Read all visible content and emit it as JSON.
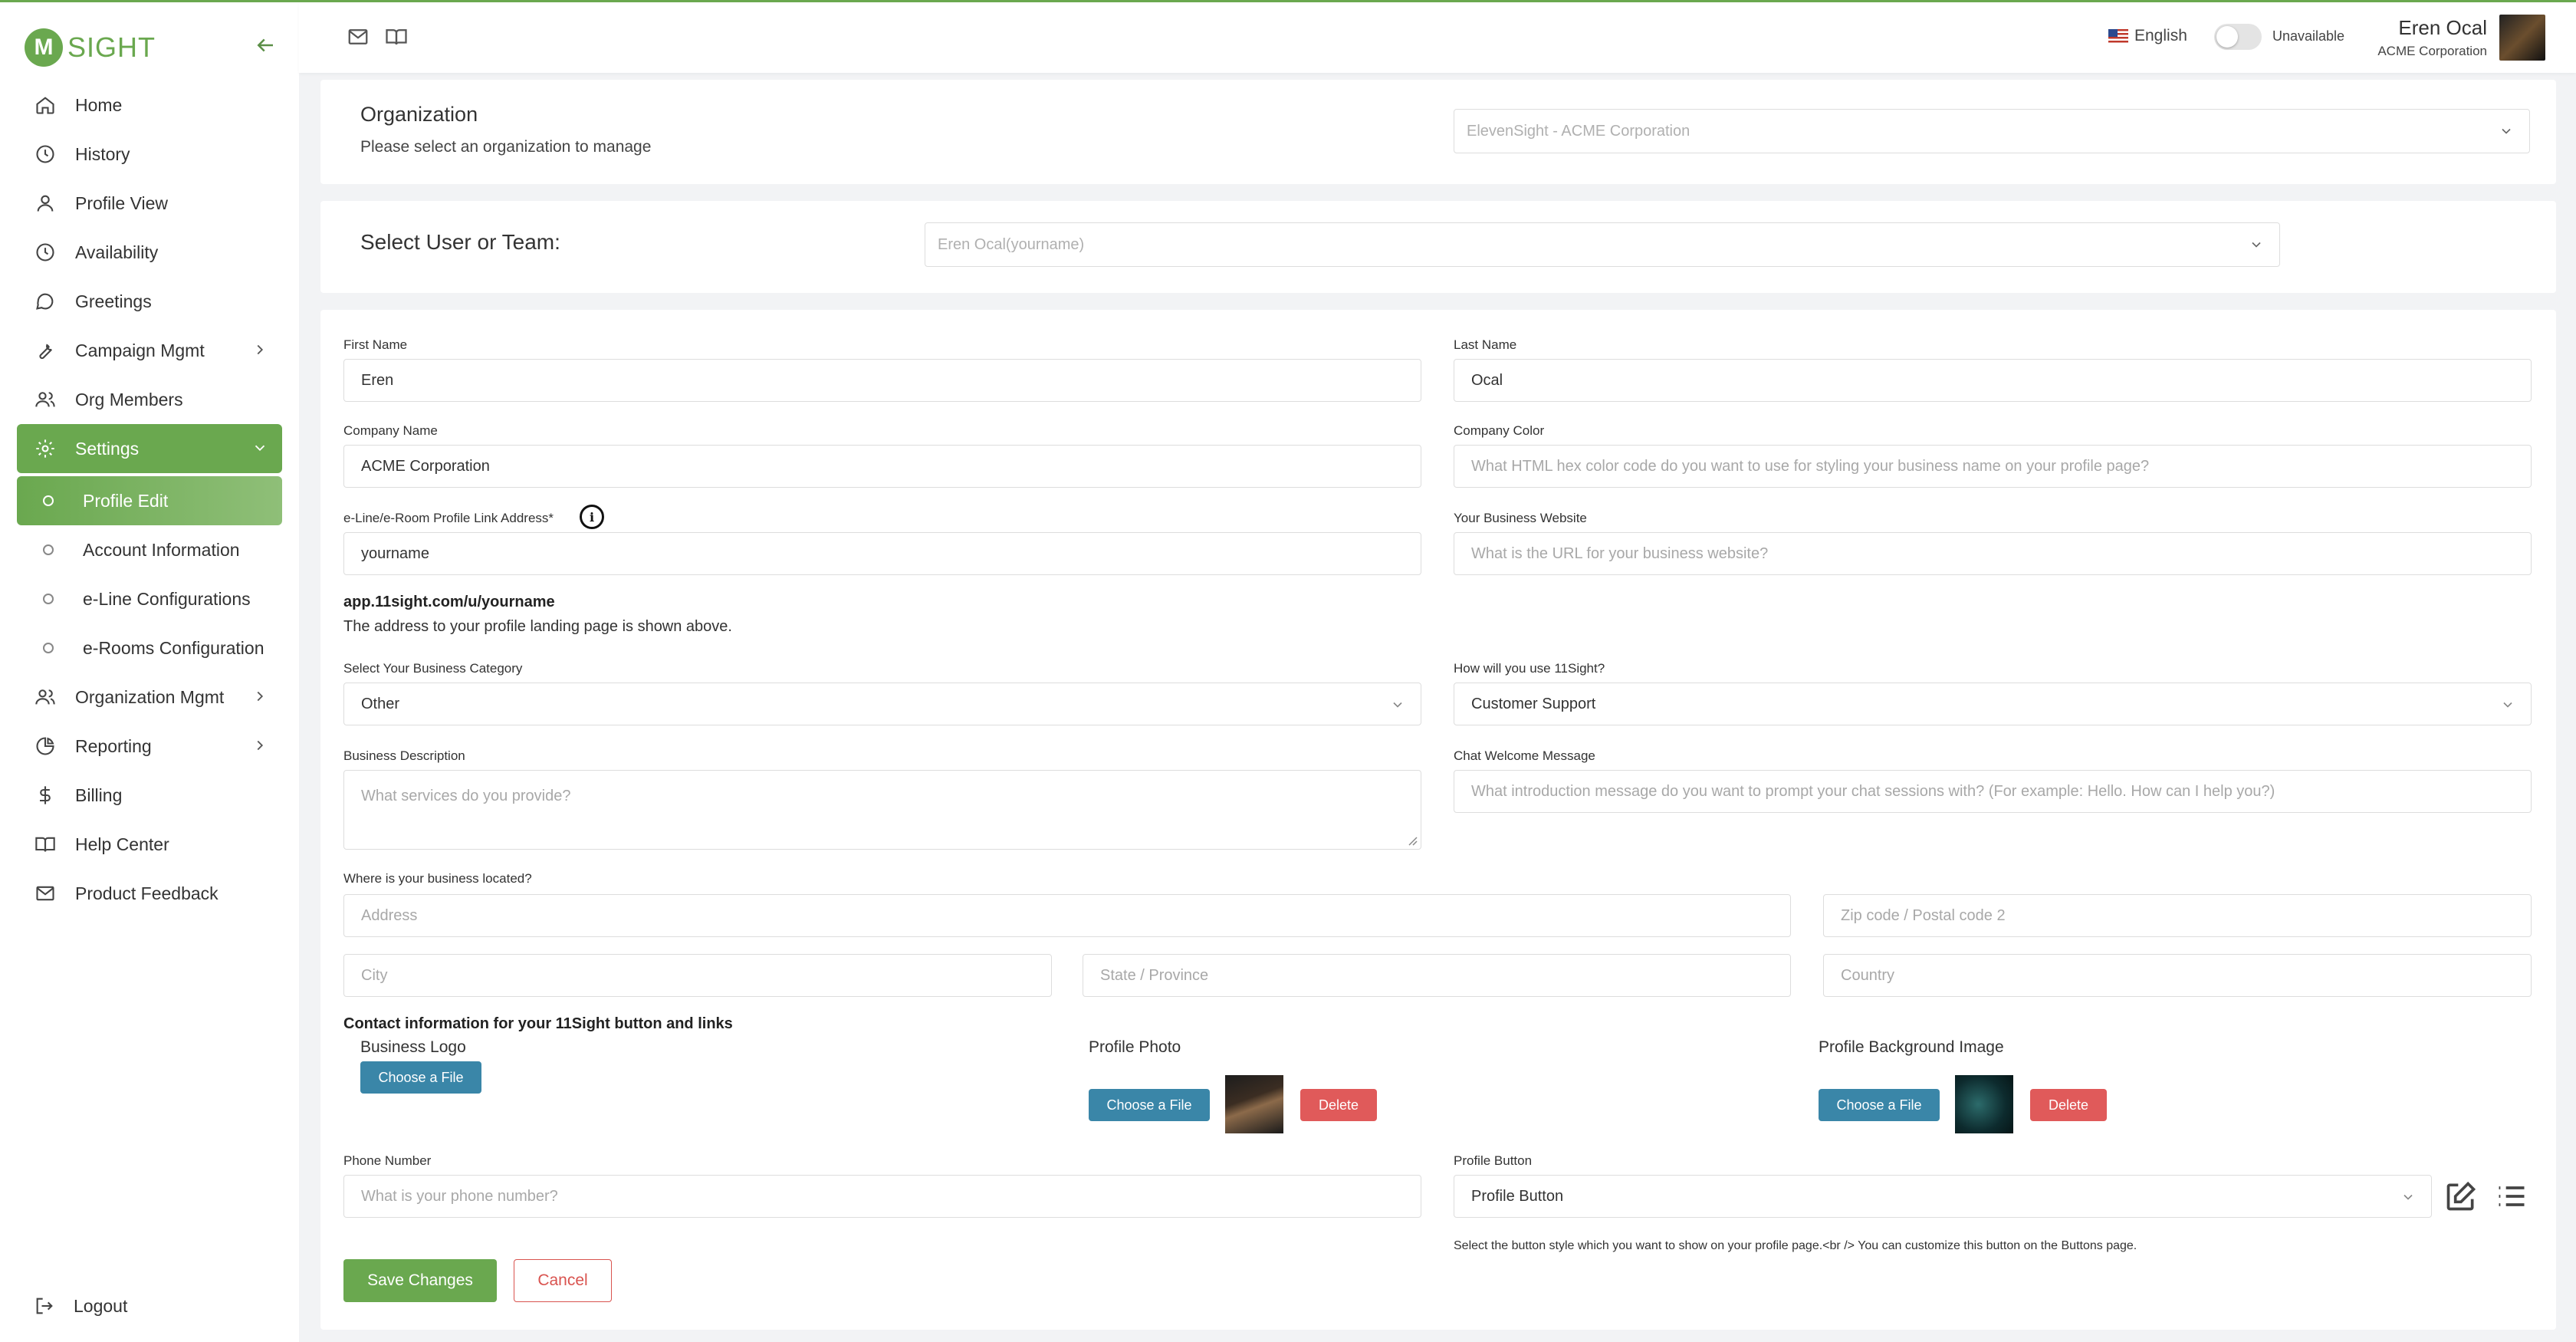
{
  "brand": {
    "logo_mark": "M",
    "logo_text": "SIGHT",
    "accent": "#6aa84f",
    "link_button_color": "#3a86a8",
    "danger_color": "#e05a5a"
  },
  "sidebar": {
    "items": [
      {
        "label": "Home",
        "icon": "home-icon"
      },
      {
        "label": "History",
        "icon": "clock-icon"
      },
      {
        "label": "Profile View",
        "icon": "user-icon"
      },
      {
        "label": "Availability",
        "icon": "clock-icon"
      },
      {
        "label": "Greetings",
        "icon": "chat-bubble-icon"
      },
      {
        "label": "Campaign Mgmt",
        "icon": "wrench-icon"
      },
      {
        "label": "Org Members",
        "icon": "users-icon"
      },
      {
        "label": "Settings",
        "icon": "gear-icon"
      },
      {
        "label": "Profile Edit"
      },
      {
        "label": "Account Information"
      },
      {
        "label": "e-Line Configurations"
      },
      {
        "label": "e-Rooms Configuration"
      },
      {
        "label": "Organization Mgmt",
        "icon": "users-icon"
      },
      {
        "label": "Reporting",
        "icon": "pie-chart-icon"
      },
      {
        "label": "Billing",
        "icon": "dollar-icon"
      },
      {
        "label": "Help Center",
        "icon": "book-icon"
      },
      {
        "label": "Product Feedback",
        "icon": "mail-icon"
      }
    ],
    "logout": "Logout"
  },
  "header": {
    "language": "English",
    "availability": "Unavailable",
    "user_name": "Eren Ocal",
    "user_org": "ACME Corporation"
  },
  "org_card": {
    "title": "Organization",
    "subtitle": "Please select an organization to manage",
    "selected": "ElevenSight - ACME Corporation"
  },
  "user_card": {
    "title": "Select User or Team:",
    "selected": "Eren Ocal(yourname)"
  },
  "form": {
    "first_name_label": "First Name",
    "first_name": "Eren",
    "last_name_label": "Last Name",
    "last_name": "Ocal",
    "company_name_label": "Company Name",
    "company_name": "ACME Corporation",
    "company_color_label": "Company Color",
    "company_color_placeholder": "What HTML hex color code do you want to use for styling your business name on your profile page?",
    "link_label": "e-Line/e-Room Profile Link Address*",
    "link_value": "yourname",
    "website_label": "Your Business Website",
    "website_placeholder": "What is the URL for your business website?",
    "link_url": "app.11sight.com/u/yourname",
    "link_helper": "The address to your profile landing page is shown above.",
    "category_label": "Select Your Business Category",
    "category_value": "Other",
    "usage_label": "How will you use 11Sight?",
    "usage_value": "Customer Support",
    "description_label": "Business Description",
    "description_placeholder": "What services do you provide?",
    "welcome_label": "Chat Welcome Message",
    "welcome_placeholder": "What introduction message do you want to prompt your chat sessions with? (For example: Hello. How can I help you?)",
    "location_label": "Where is your business located?",
    "address_placeholder": "Address",
    "zip_placeholder": "Zip code / Postal code 2",
    "city_placeholder": "City",
    "state_placeholder": "State / Province",
    "country_placeholder": "Country",
    "contact_title": "Contact information for your 11Sight button and links",
    "logo_label": "Business Logo",
    "photo_label": "Profile Photo",
    "bg_label": "Profile Background Image",
    "choose_file": "Choose a File",
    "delete": "Delete",
    "phone_label": "Phone Number",
    "phone_placeholder": "What is your phone number?",
    "profile_button_label": "Profile Button",
    "profile_button_value": "Profile Button",
    "profile_button_help": "Select the button style which you want to show on your profile page.<br /> You can customize this button on the Buttons page.",
    "save": "Save Changes",
    "cancel": "Cancel"
  }
}
